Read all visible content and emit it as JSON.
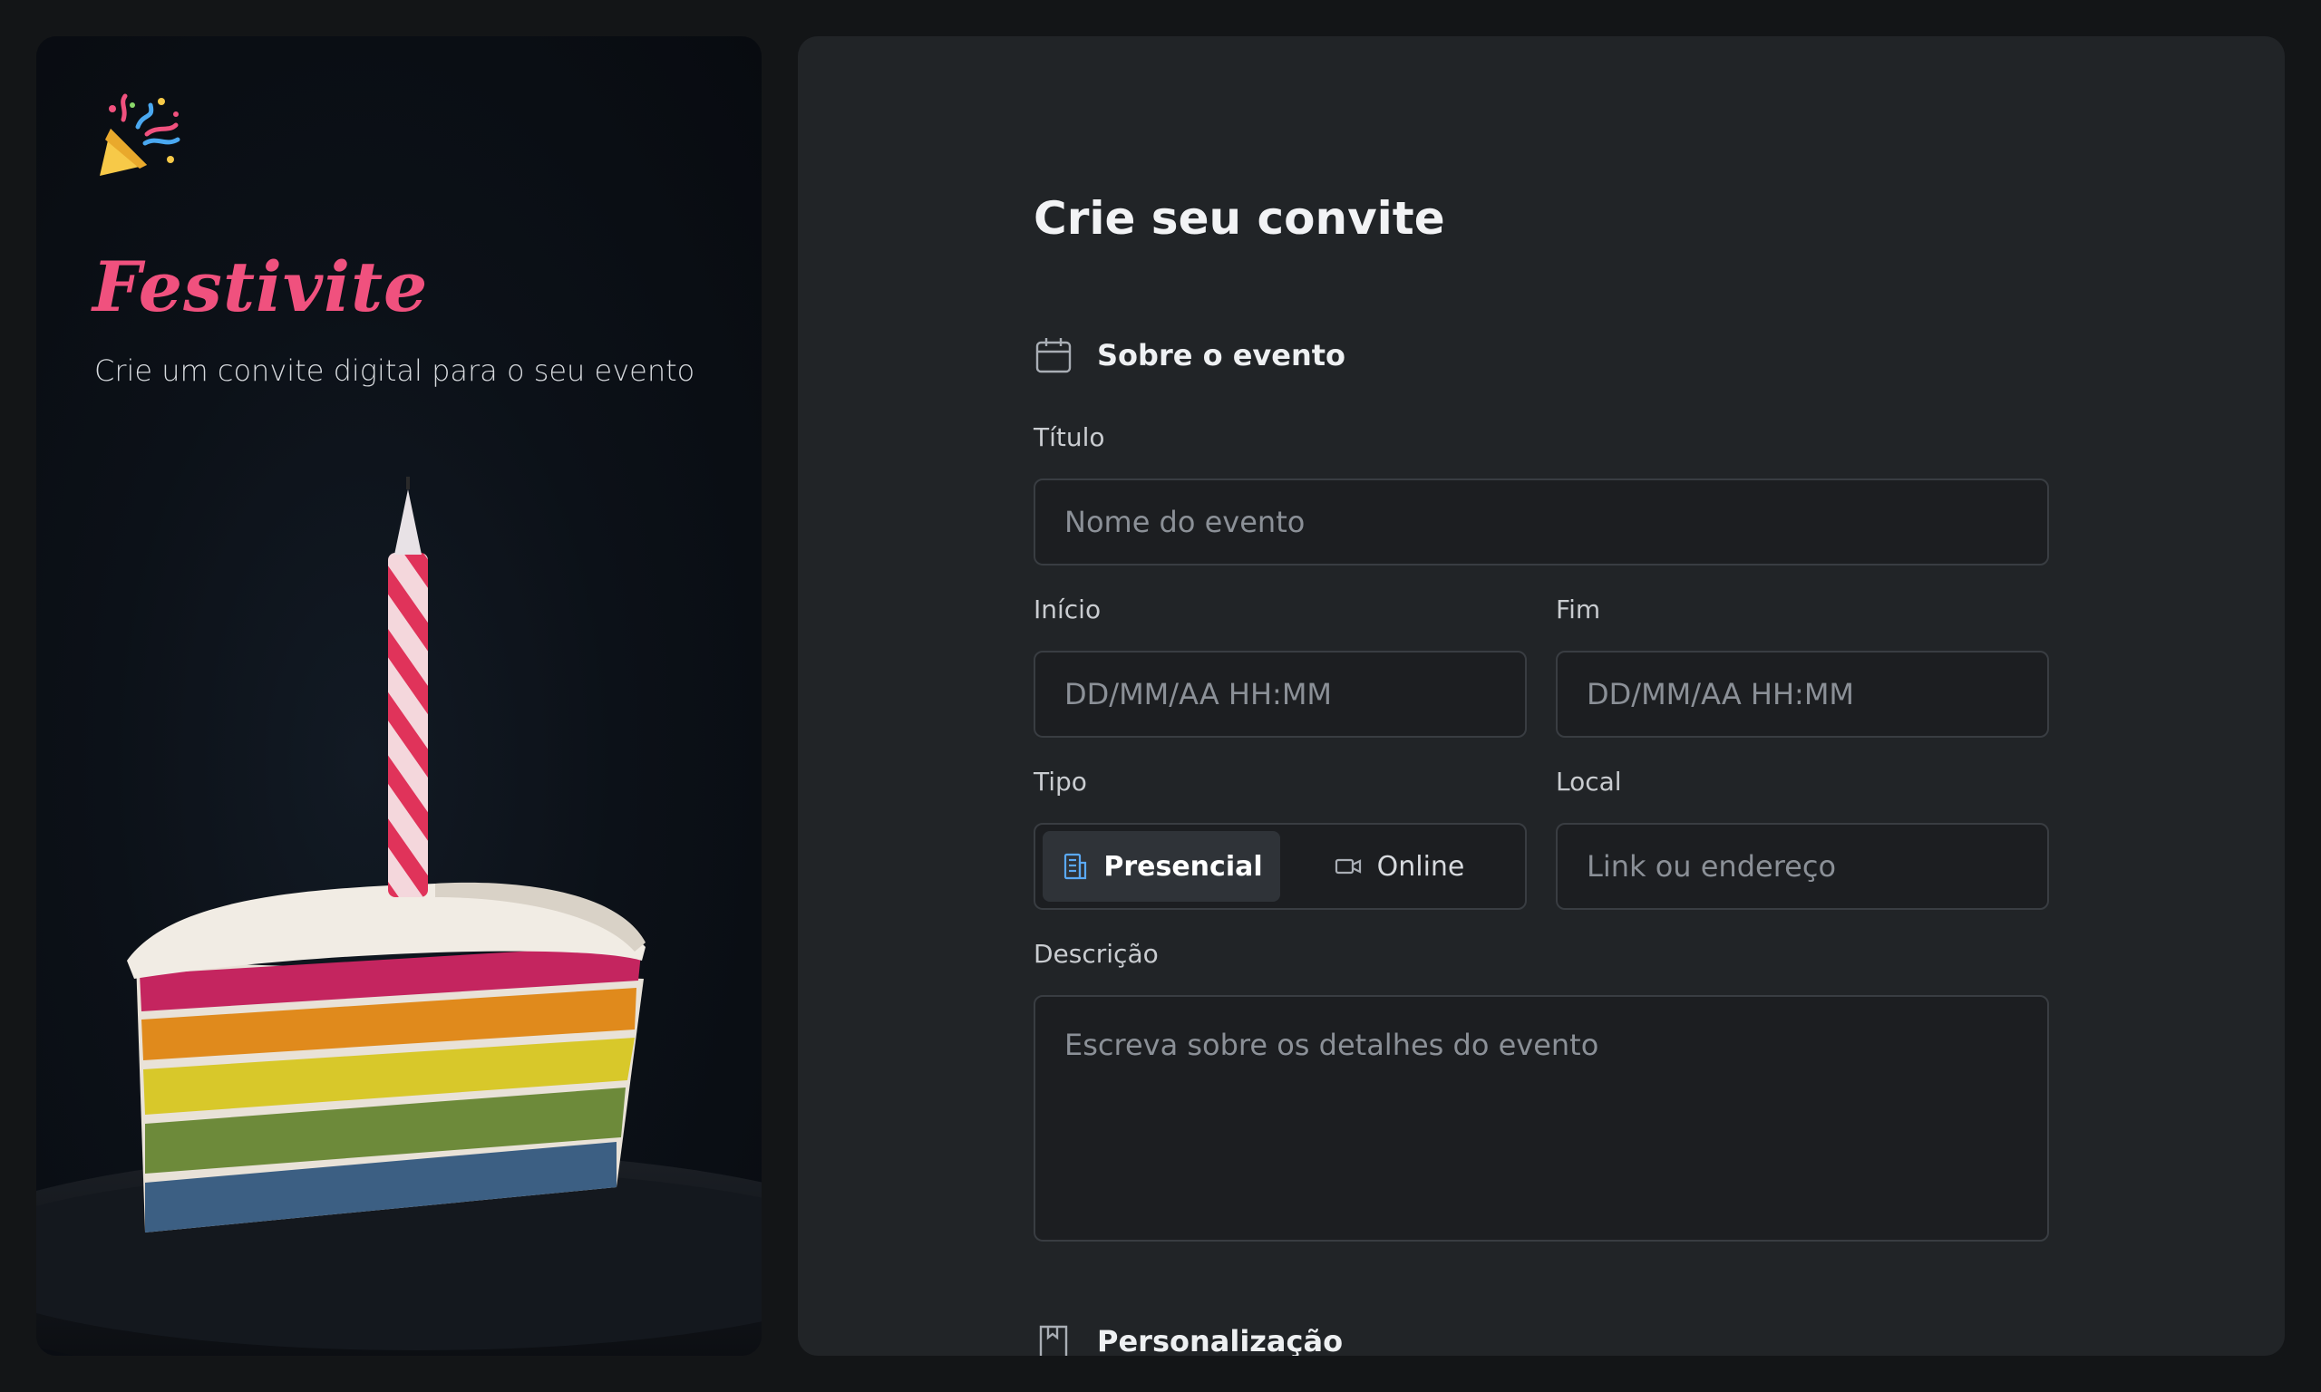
{
  "brand": {
    "name": "Festivite",
    "tagline": "Crie um convite digital para o seu evento",
    "accent_color": "#f0517e",
    "logo_icon": "party-popper-icon"
  },
  "form": {
    "title": "Crie seu convite",
    "sections": {
      "about": {
        "label": "Sobre o evento",
        "icon": "calendar-icon"
      },
      "custom": {
        "label": "Personalização",
        "icon": "book-icon"
      }
    },
    "fields": {
      "title": {
        "label": "Título",
        "placeholder": "Nome do evento"
      },
      "start": {
        "label": "Início",
        "placeholder": "DD/MM/AA HH:MM"
      },
      "end": {
        "label": "Fim",
        "placeholder": "DD/MM/AA HH:MM"
      },
      "type": {
        "label": "Tipo",
        "options": [
          {
            "label": "Presencial",
            "icon": "building-icon",
            "selected": true
          },
          {
            "label": "Online",
            "icon": "video-camera-icon",
            "selected": false
          }
        ]
      },
      "location": {
        "label": "Local",
        "placeholder": "Link ou endereço"
      },
      "description": {
        "label": "Descrição",
        "placeholder": "Escreva sobre os detalhes do evento"
      }
    }
  }
}
